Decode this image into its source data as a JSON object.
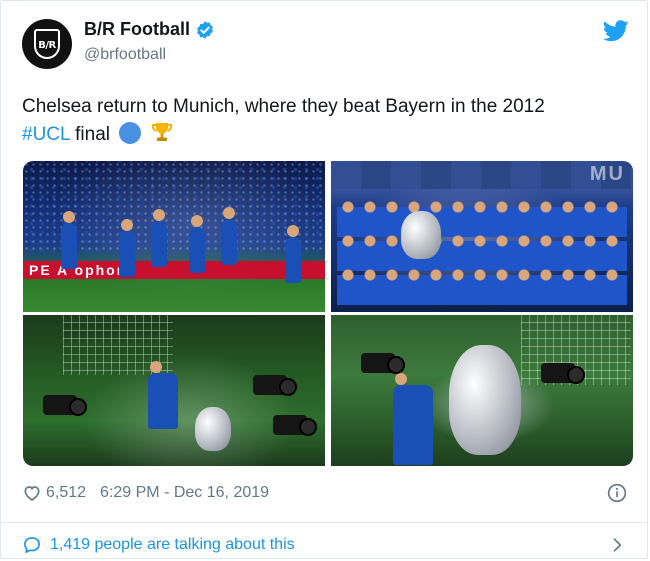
{
  "account": {
    "avatar_text": "B/R",
    "display_name": "B/R Football",
    "handle": "@brfootball"
  },
  "tweet": {
    "text_part1": "Chelsea return to Munich, where they beat Bayern in the 2012",
    "hashtag": "#UCL",
    "text_part2": "final"
  },
  "photos": {
    "photo1_adboard": "PE  A    ophon"
  },
  "meta": {
    "likes": "6,512",
    "time": "6:29 PM - Dec 16, 2019"
  },
  "talking": {
    "label": "1,419 people are talking about this"
  },
  "colors": {
    "link": "#1b95e0",
    "text": "#14171a",
    "secondary": "#657786",
    "verified": "#1da1f2"
  },
  "icons": [
    "avatar-logo",
    "verified-icon",
    "twitter-logo-icon",
    "blue-circle-emoji-icon",
    "trophy-emoji-icon",
    "heart-icon",
    "info-icon",
    "comment-icon",
    "chevron-right-icon"
  ]
}
